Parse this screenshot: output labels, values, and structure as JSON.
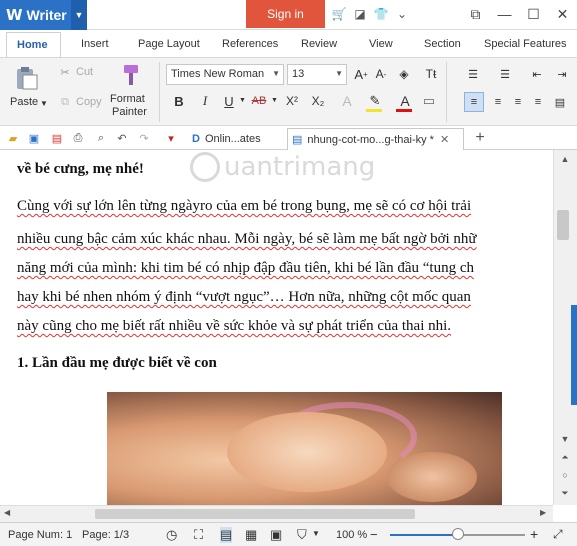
{
  "app": {
    "name": "Writer",
    "logo": "W",
    "signin": "Sign in",
    "colors": {
      "brand": "#2b72c6",
      "signin": "#e1553d"
    }
  },
  "titlebar_icons": [
    "cart-icon",
    "skin-icon",
    "shirt-icon",
    "chevron-down-icon"
  ],
  "menu": {
    "tabs": [
      "Home",
      "Insert",
      "Page Layout",
      "References",
      "Review",
      "View",
      "Section",
      "Special Features"
    ],
    "active": "Home"
  },
  "ribbon": {
    "paste": "Paste",
    "cut": "Cut",
    "copy": "Copy",
    "format_painter_1": "Format",
    "format_painter_2": "Painter",
    "font": "Times New Roman",
    "size": "13",
    "bold": "B",
    "italic": "I",
    "underline": "U",
    "strike": "AB",
    "superscript": "X²",
    "subscript": "X₂"
  },
  "doc_tabs": [
    {
      "label": "Onlin...ates",
      "active": false
    },
    {
      "label": "nhung-cot-mo...g-thai-ky *",
      "active": true
    }
  ],
  "document": {
    "lines": [
      "về bé cưng, mẹ nhé!",
      "Cùng với sự lớn lên từng ngàyro của em bé trong bụng, mẹ sẽ có cơ hội trải",
      "nhiều cung bậc cảm xúc khác nhau. Mỗi ngày, bé sẽ làm mẹ bất ngờ bởi nhữ",
      "năng mới của mình: khi tim bé có nhịp đập đầu tiên, khi bé lần đầu “tung ch",
      "hay khi bé nhen nhóm ý định “vượt ngục”… Hơn nữa, những cột mốc quan",
      "này cũng cho mẹ biết rất nhiều về sức khỏe và sự phát triển của thai nhi."
    ],
    "heading": "1.  Lần đầu mẹ được biết về con",
    "watermark": "uantrimang"
  },
  "status": {
    "page_num": "Page Num: 1",
    "page": "Page: 1/3",
    "zoom": "100 %",
    "zoom_level": 0.5
  }
}
